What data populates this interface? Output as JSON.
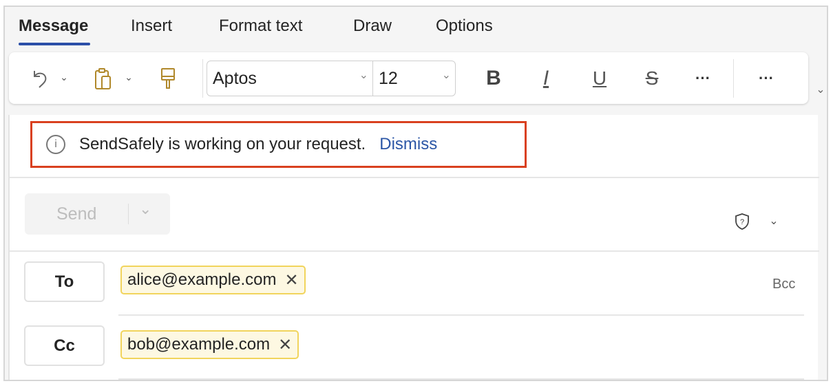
{
  "tabs": [
    {
      "label": "Message",
      "active": true
    },
    {
      "label": "Insert"
    },
    {
      "label": "Format text"
    },
    {
      "label": "Draw"
    },
    {
      "label": "Options"
    }
  ],
  "toolbar": {
    "font": "Aptos",
    "size": "12",
    "bold": "B",
    "italic": "I",
    "underline": "U",
    "strike": "S",
    "more": "···",
    "overflow": "···"
  },
  "notice": {
    "text": "SendSafely is working on your request.",
    "dismiss": "Dismiss"
  },
  "compose": {
    "send_label": "Send",
    "to_label": "To",
    "cc_label": "Cc",
    "bcc_label": "Bcc",
    "to": [
      "alice@example.com"
    ],
    "cc": [
      "bob@example.com"
    ]
  },
  "colors": {
    "accent": "#2b4fa8",
    "highlight": "#d9401f",
    "chip_border": "#f1d45c",
    "chip_bg": "#fdf8e2"
  }
}
